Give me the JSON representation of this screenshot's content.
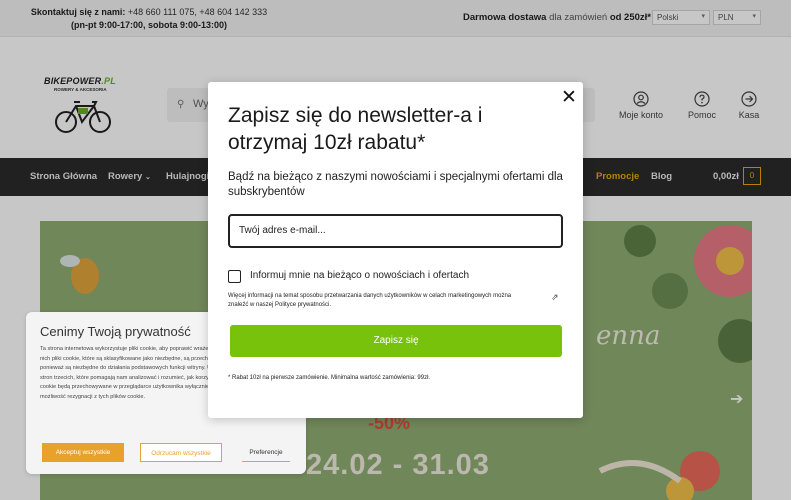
{
  "topbar": {
    "contact_line1_label": "Skontaktuj się z nami:",
    "contact_line1_phones": "+48 660 111 075, +48 604 142 333",
    "contact_line2": "(pn-pt 9:00-17:00, sobota 9:00-13:00)",
    "shipping_bold1": "Darmowa dostawa",
    "shipping_text": "dla zamówień",
    "shipping_bold2": "od 250zł*",
    "language": "Polski",
    "currency": "PLN"
  },
  "header": {
    "logo_text_1": "BIKEPOWER",
    "logo_text_2": ".PL",
    "logo_sub": "ROWERY & AKCESORIA",
    "search_placeholder": "Wy",
    "account_label": "Moje konto",
    "help_label": "Pomoc",
    "checkout_label": "Kasa"
  },
  "nav": {
    "home": "Strona Główna",
    "bikes": "Rowery",
    "scooters": "Hulajnogi",
    "promotions": "Promocje",
    "blog": "Blog",
    "cart_total": "0,00zł",
    "cart_count": "0"
  },
  "banner": {
    "discount": "-50%",
    "dates": "24.02 - 31.03",
    "script_text": "enna"
  },
  "cookie": {
    "title": "Cenimy Twoją prywatność",
    "text": "Ta strona internetowa wykorzystuje pliki cookie, aby poprawić wrażenia z korzystania z niej. Spośród nich pliki cookie, które są sklasyfikowane jako niezbędne, są przechowywane w przeglądarce, ponieważ są niezbędne do działania podstawowych funkcji witryny. Używamy również plików cookie stron trzecich, które pomagają nam analizować i rozumieć, jak korzystasz z tej witryny. Te pliki cookie będą przechowywane w przeglądarce użytkownika wyłącznie za jego zgodą. Masz również możliwość rezygnacji z tych plików cookie.",
    "accept_label": "Akceptuj wszystkie",
    "reject_label": "Odrzucam wszystkie",
    "prefs_label": "Preferencje",
    "accent_color": "#e8a22c"
  },
  "modal": {
    "close_symbol": "✕",
    "title": "Zapisz się do newsletter-a i otrzymaj 10zł rabatu*",
    "subtitle": "Bądź na bieżąco z naszymi nowościami i specjalnymi ofertami dla subskrybentów",
    "email_placeholder": "Twój adres e-mail...",
    "checkbox_label": "Informuj mnie na bieżąco o nowościach i ofertach",
    "info_text": "Więcej informacji na temat sposobu przetwarzania danych użytkowników w celach marketingowych można znaleźć w naszej Polityce prywatności.",
    "submit_label": "Zapisz się",
    "footnote": "* Rabat 10zł na pierwsze zamówienie. Minimalna wartość zamówienia: 99zł.",
    "submit_color": "#79c20c"
  }
}
